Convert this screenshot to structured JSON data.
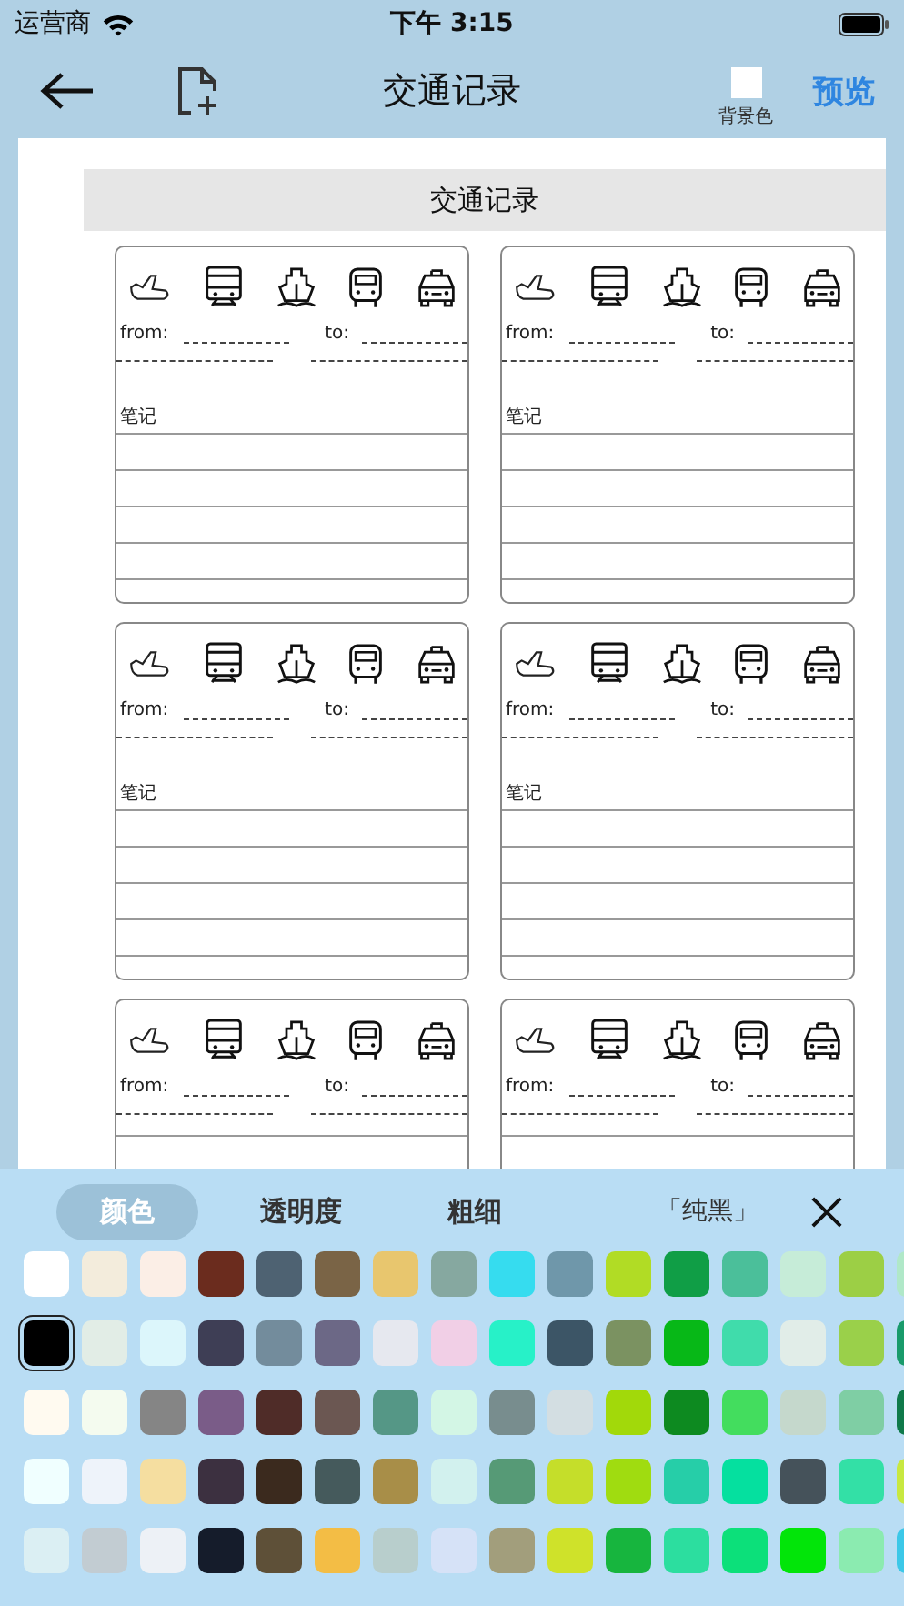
{
  "status_bar": {
    "carrier": "运营商",
    "time": "下午 3:15"
  },
  "nav": {
    "title": "交通记录",
    "background_label": "背景色",
    "preview": "预览"
  },
  "sheet": {
    "title": "交通记录",
    "cards": [
      {
        "from_label": "from:",
        "to_label": "to:",
        "notes_label": "笔记"
      },
      {
        "from_label": "from:",
        "to_label": "to:",
        "notes_label": "笔记"
      },
      {
        "from_label": "from:",
        "to_label": "to:",
        "notes_label": "笔记"
      },
      {
        "from_label": "from:",
        "to_label": "to:",
        "notes_label": "笔记"
      },
      {
        "from_label": "from:",
        "to_label": "to:"
      },
      {
        "from_label": "from:",
        "to_label": "to:"
      }
    ]
  },
  "panel": {
    "tabs": [
      {
        "label": "颜色",
        "selected": true
      },
      {
        "label": "透明度",
        "selected": false
      },
      {
        "label": "粗细",
        "selected": false
      }
    ],
    "current_color": "「纯黑」",
    "swatch_rows": [
      {
        "swatches": [
          {
            "color": "#ffffff",
            "selected": false
          },
          {
            "color": "#f3ecdc",
            "selected": false
          },
          {
            "color": "#fbeee6",
            "selected": false
          },
          {
            "color": "#6b2c1e",
            "selected": false
          },
          {
            "color": "#4e6272",
            "selected": false
          },
          {
            "color": "#7a6446",
            "selected": false
          },
          {
            "color": "#e8c66e",
            "selected": false
          },
          {
            "color": "#86a8a0",
            "selected": false
          },
          {
            "color": "#36dcef",
            "selected": false
          },
          {
            "color": "#6f97aa",
            "selected": false
          },
          {
            "color": "#b1dc25",
            "selected": false
          },
          {
            "color": "#109e46",
            "selected": false
          },
          {
            "color": "#4bbf9a",
            "selected": false
          },
          {
            "color": "#c6ecd8",
            "selected": false
          },
          {
            "color": "#9ccf45",
            "selected": false
          },
          {
            "color": "#b0e8c8",
            "selected": false
          }
        ]
      },
      {
        "swatches": [
          {
            "color": "#000000",
            "selected": true
          },
          {
            "color": "#e2ede6",
            "selected": false
          },
          {
            "color": "#dcf6fb",
            "selected": false
          },
          {
            "color": "#3e3e55",
            "selected": false
          },
          {
            "color": "#738c9c",
            "selected": false
          },
          {
            "color": "#6c6886",
            "selected": false
          },
          {
            "color": "#e6e8ef",
            "selected": false
          },
          {
            "color": "#f1cfe6",
            "selected": false
          },
          {
            "color": "#27f1c8",
            "selected": false
          },
          {
            "color": "#3c5566",
            "selected": false
          },
          {
            "color": "#7b9261",
            "selected": false
          },
          {
            "color": "#07b817",
            "selected": false
          },
          {
            "color": "#40dcab",
            "selected": false
          },
          {
            "color": "#e1ede8",
            "selected": false
          },
          {
            "color": "#9ad04a",
            "selected": false
          },
          {
            "color": "#199b6b",
            "selected": false
          }
        ]
      },
      {
        "swatches": [
          {
            "color": "#fffaf0",
            "selected": false
          },
          {
            "color": "#f4fbef",
            "selected": false
          },
          {
            "color": "#858585",
            "selected": false
          },
          {
            "color": "#7a5c88",
            "selected": false
          },
          {
            "color": "#4f2c28",
            "selected": false
          },
          {
            "color": "#6b5752",
            "selected": false
          },
          {
            "color": "#559786",
            "selected": false
          },
          {
            "color": "#d3f6e5",
            "selected": false
          },
          {
            "color": "#788d8e",
            "selected": false
          },
          {
            "color": "#d3dee2",
            "selected": false
          },
          {
            "color": "#a2d90a",
            "selected": false
          },
          {
            "color": "#0d8a20",
            "selected": false
          },
          {
            "color": "#43dd5e",
            "selected": false
          },
          {
            "color": "#c5d8cc",
            "selected": false
          },
          {
            "color": "#7fcea4",
            "selected": false
          },
          {
            "color": "#0f7a4a",
            "selected": false
          }
        ]
      },
      {
        "swatches": [
          {
            "color": "#f0ffff",
            "selected": false
          },
          {
            "color": "#eef3fa",
            "selected": false
          },
          {
            "color": "#f5dea0",
            "selected": false
          },
          {
            "color": "#3c3040",
            "selected": false
          },
          {
            "color": "#3b2a1e",
            "selected": false
          },
          {
            "color": "#455a5c",
            "selected": false
          },
          {
            "color": "#a88e48",
            "selected": false
          },
          {
            "color": "#d2f1ee",
            "selected": false
          },
          {
            "color": "#569a76",
            "selected": false
          },
          {
            "color": "#c5de2a",
            "selected": false
          },
          {
            "color": "#a0dc10",
            "selected": false
          },
          {
            "color": "#26cea8",
            "selected": false
          },
          {
            "color": "#05e09f",
            "selected": false
          },
          {
            "color": "#45525a",
            "selected": false
          },
          {
            "color": "#33e0a6",
            "selected": false
          },
          {
            "color": "#c8e840",
            "selected": false
          }
        ]
      },
      {
        "swatches": [
          {
            "color": "#dbeff3",
            "selected": false
          },
          {
            "color": "#c2ccd2",
            "selected": false
          },
          {
            "color": "#edf1f6",
            "selected": false
          },
          {
            "color": "#151c2b",
            "selected": false
          },
          {
            "color": "#5e5038",
            "selected": false
          },
          {
            "color": "#f3bd45",
            "selected": false
          },
          {
            "color": "#b8cecc",
            "selected": false
          },
          {
            "color": "#d6e2f7",
            "selected": false
          },
          {
            "color": "#a29e7c",
            "selected": false
          },
          {
            "color": "#cfe22a",
            "selected": false
          },
          {
            "color": "#17b53e",
            "selected": false
          },
          {
            "color": "#2cde9f",
            "selected": false
          },
          {
            "color": "#0ce07a",
            "selected": false
          },
          {
            "color": "#02e509",
            "selected": false
          },
          {
            "color": "#8bebb0",
            "selected": false
          },
          {
            "color": "#3cc8e8",
            "selected": false
          }
        ]
      }
    ]
  }
}
